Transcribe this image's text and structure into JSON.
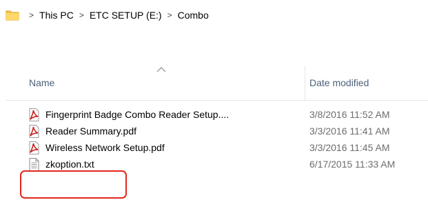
{
  "breadcrumb": {
    "items": [
      "This PC",
      "ETC SETUP (E:)",
      "Combo"
    ],
    "separator": ">"
  },
  "columns": {
    "name": "Name",
    "date_modified": "Date modified"
  },
  "files": [
    {
      "name": "Fingerprint Badge Combo Reader Setup....",
      "date": "3/8/2016 11:52 AM",
      "icon": "pdf-icon"
    },
    {
      "name": "Reader Summary.pdf",
      "date": "3/3/2016 11:41 AM",
      "icon": "pdf-icon"
    },
    {
      "name": "Wireless Network Setup.pdf",
      "date": "3/3/2016 11:45 AM",
      "icon": "pdf-icon"
    },
    {
      "name": "zkoption.txt",
      "date": "6/17/2015 11:33 AM",
      "icon": "txt-icon"
    }
  ],
  "colors": {
    "header_text": "#4c607a",
    "date_text": "#6d6d6d",
    "highlight": "#e2251c",
    "folder": "#f5c447",
    "pdf": "#c9201c"
  },
  "highlighted_file": "zkoption.txt"
}
